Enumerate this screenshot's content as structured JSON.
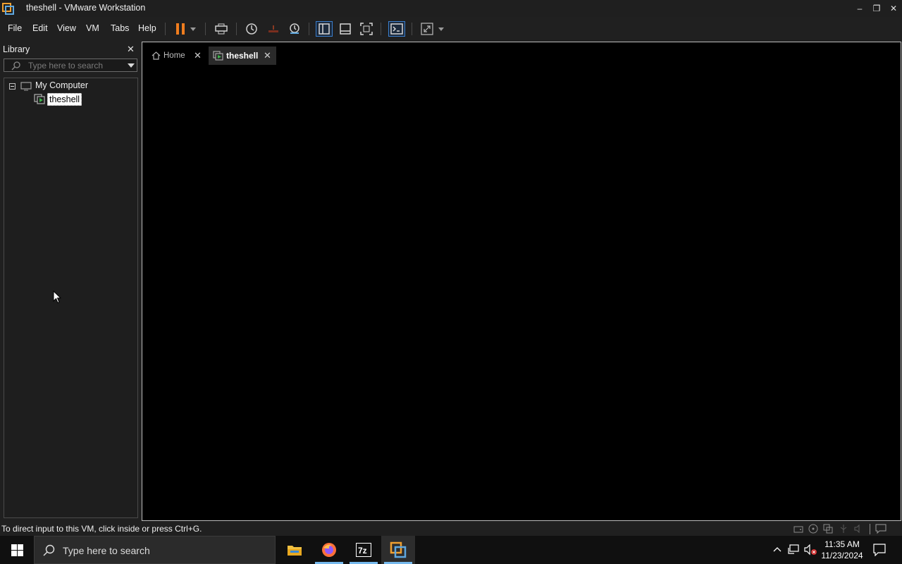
{
  "window": {
    "title": "theshell - VMware Workstation"
  },
  "menu": {
    "file": "File",
    "edit": "Edit",
    "view": "View",
    "vm": "VM",
    "tabs": "Tabs",
    "help": "Help"
  },
  "library": {
    "title": "Library",
    "search_placeholder": "Type here to search",
    "tree": {
      "root": "My Computer",
      "child": "theshell"
    }
  },
  "tabs": [
    {
      "label": "Home",
      "active": false
    },
    {
      "label": "theshell",
      "active": true
    }
  ],
  "status": {
    "message": "To direct input to this VM, click inside or press Ctrl+G."
  },
  "taskbar": {
    "search_placeholder": "Type here to search",
    "time": "11:35 AM",
    "date": "11/23/2024"
  },
  "colors": {
    "accent": "#3a7fcf",
    "pause_orange": "#f07d1e",
    "taskbar_underline": "#76b9ed"
  }
}
